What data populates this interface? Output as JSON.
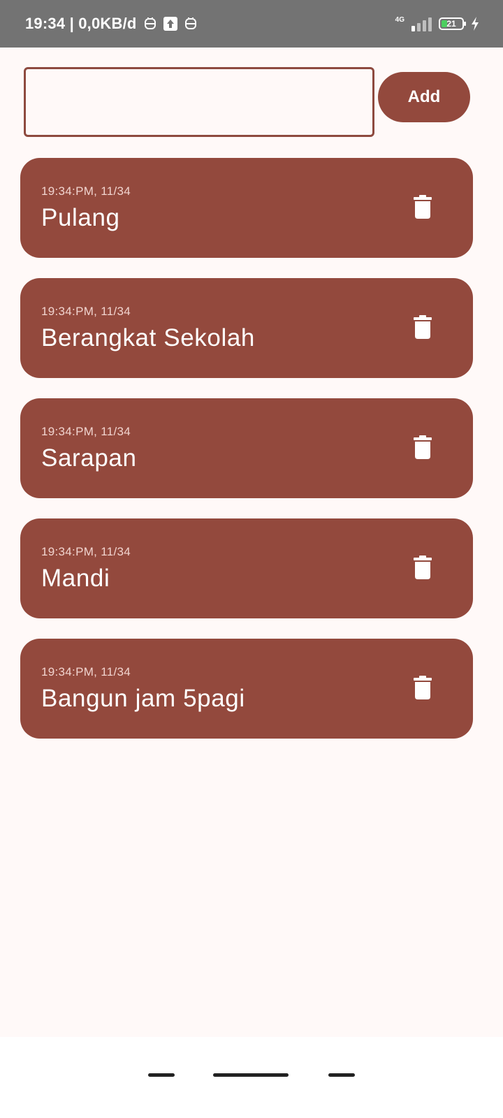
{
  "status_bar": {
    "time_and_speed": "19:34 | 0,0KB/d",
    "network": "4G",
    "battery": "21",
    "icons": [
      "app-notification-icon",
      "upload-icon",
      "app-notification-icon",
      "signal-icon",
      "battery-icon",
      "charging-icon"
    ]
  },
  "input": {
    "value": "",
    "placeholder": ""
  },
  "add_button": {
    "label": "Add"
  },
  "tasks": [
    {
      "time": "19:34:PM, 11/34",
      "title": "Pulang"
    },
    {
      "time": "19:34:PM, 11/34",
      "title": "Berangkat Sekolah"
    },
    {
      "time": "19:34:PM, 11/34",
      "title": "Sarapan"
    },
    {
      "time": "19:34:PM, 11/34",
      "title": "Mandi"
    },
    {
      "time": "19:34:PM, 11/34",
      "title": "Bangun jam 5pagi"
    }
  ],
  "colors": {
    "card": "#93493d",
    "input_border": "#8e4a3f",
    "background": "#fff9f8",
    "status_bar": "#737373"
  },
  "nav_bar": {
    "buttons": [
      "recents-button",
      "home-button",
      "back-button"
    ]
  }
}
